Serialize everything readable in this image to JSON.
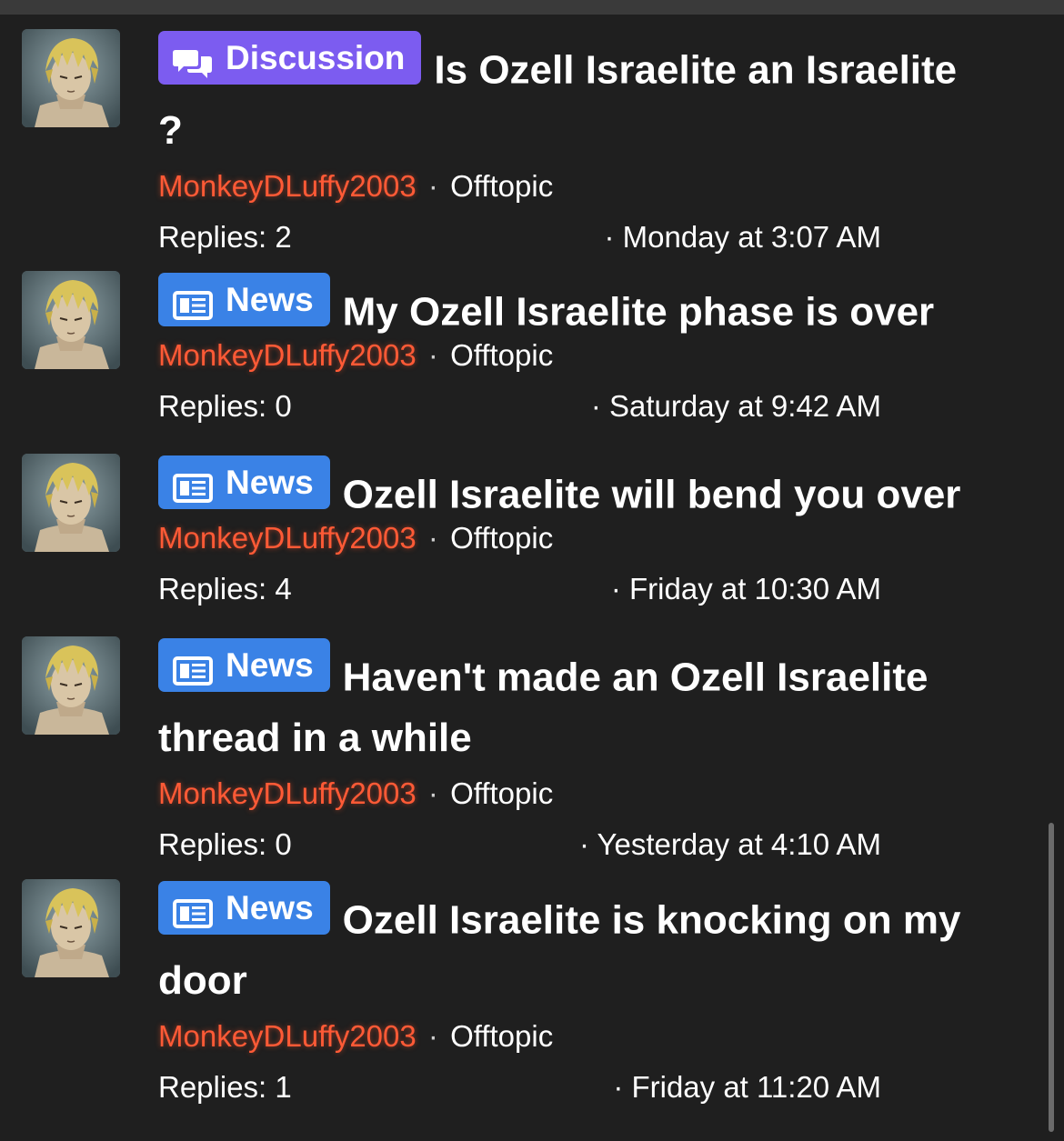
{
  "threads": [
    {
      "prefix": {
        "label": "Discussion",
        "type": "discussion",
        "icon": "chat-bubbles-icon",
        "color": "#7c5cf0"
      },
      "title_inline": "Is Ozell Israelite an Israelite",
      "title_wrap": "?",
      "author": "MonkeyDLuffy2003",
      "forum": "Offtopic",
      "replies": "Replies: 2",
      "last_date": "· Monday at 3:07 AM"
    },
    {
      "prefix": {
        "label": "News",
        "type": "news",
        "icon": "newspaper-icon",
        "color": "#3a82e6"
      },
      "title_inline": "My Ozell Israelite phase is over",
      "title_wrap": "",
      "author": "MonkeyDLuffy2003",
      "forum": "Offtopic",
      "replies": "Replies: 0",
      "last_date": "· Saturday at 9:42 AM"
    },
    {
      "prefix": {
        "label": "News",
        "type": "news",
        "icon": "newspaper-icon",
        "color": "#3a82e6"
      },
      "title_inline": "Ozell Israelite will bend you over",
      "title_wrap": "",
      "author": "MonkeyDLuffy2003",
      "forum": "Offtopic",
      "replies": "Replies: 4",
      "last_date": "· Friday at 10:30 AM"
    },
    {
      "prefix": {
        "label": "News",
        "type": "news",
        "icon": "newspaper-icon",
        "color": "#3a82e6"
      },
      "title_inline": "Haven't made an Ozell Israelite",
      "title_wrap": "thread in a while",
      "author": "MonkeyDLuffy2003",
      "forum": "Offtopic",
      "replies": "Replies: 0",
      "last_date": "· Yesterday at 4:10 AM"
    },
    {
      "prefix": {
        "label": "News",
        "type": "news",
        "icon": "newspaper-icon",
        "color": "#3a82e6"
      },
      "title_inline": "Ozell Israelite is knocking on my",
      "title_wrap": "door",
      "author": "MonkeyDLuffy2003",
      "forum": "Offtopic",
      "replies": "Replies: 1",
      "last_date": "· Friday at 11:20 AM"
    }
  ],
  "separator": "·",
  "colors": {
    "background": "#1f1f1f",
    "author": "#ff5a36",
    "discussion_badge": "#7c5cf0",
    "news_badge": "#3a82e6"
  }
}
